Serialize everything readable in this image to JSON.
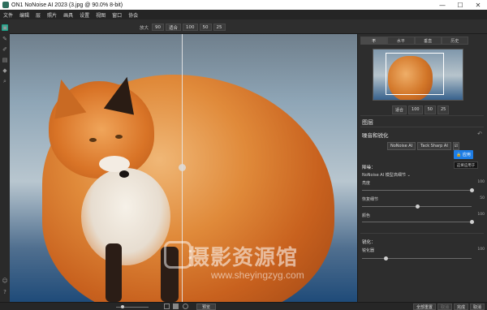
{
  "titlebar": {
    "title": "ON1 NoNoise AI 2023 (3.jpg @ 90.0% 8-bit)"
  },
  "window_controls": {
    "minimize": "—",
    "maximize": "☐",
    "close": "✕"
  },
  "menubar": {
    "items": [
      "文件",
      "编辑",
      "层",
      "照片",
      "画具",
      "设置",
      "视图",
      "窗口",
      "协会"
    ]
  },
  "toolbar": {
    "zoom_label": "放大",
    "zoom_value": "90",
    "fit_label": "适合",
    "z100": "100",
    "z50": "50",
    "z25": "25"
  },
  "canvas": {
    "watermark_cn": "摄影资源馆",
    "watermark_url": "www.sheyingzyg.com"
  },
  "panel": {
    "tabs": [
      "不",
      "水平",
      "垂直",
      "历史"
    ],
    "nav_zoom": [
      "适合",
      "100",
      "50",
      "25"
    ],
    "layers_title": "图层",
    "section_title": "噪音和锐化",
    "modes": [
      "NoNoise AI",
      "Tack Sharp AI",
      "☑"
    ],
    "apply": "🔒 应用",
    "tooltip": "这将应用于",
    "denoise_header": "降噪：",
    "model_label": "NoNoise AI 模型",
    "model_value": "高细节 ⌄",
    "sliders": [
      {
        "label": "亮度",
        "value": "100",
        "level": 1.0
      },
      {
        "label": "恢复细节",
        "value": "50",
        "level": 0.5
      },
      {
        "label": "颜色",
        "value": "100",
        "level": 1.0
      }
    ],
    "sharpen_header": "锐化：",
    "sharpen_slider": {
      "label": "锐化器",
      "value": "100",
      "level": 0.2
    }
  },
  "statusbar": {
    "preview": "预览",
    "reset_all": "全部重置",
    "cancel_dim": "取消",
    "done": "完成",
    "cancel": "取消"
  }
}
